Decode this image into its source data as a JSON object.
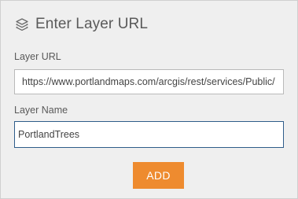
{
  "panel": {
    "title": "Enter Layer URL",
    "title_icon": "layers-icon"
  },
  "url_field": {
    "label": "Layer URL",
    "value": "https://www.portlandmaps.com/arcgis/rest/services/Public/"
  },
  "name_field": {
    "label": "Layer Name",
    "value": "PortlandTrees"
  },
  "add_button": {
    "label": "ADD",
    "color": "#ee8b2f"
  }
}
